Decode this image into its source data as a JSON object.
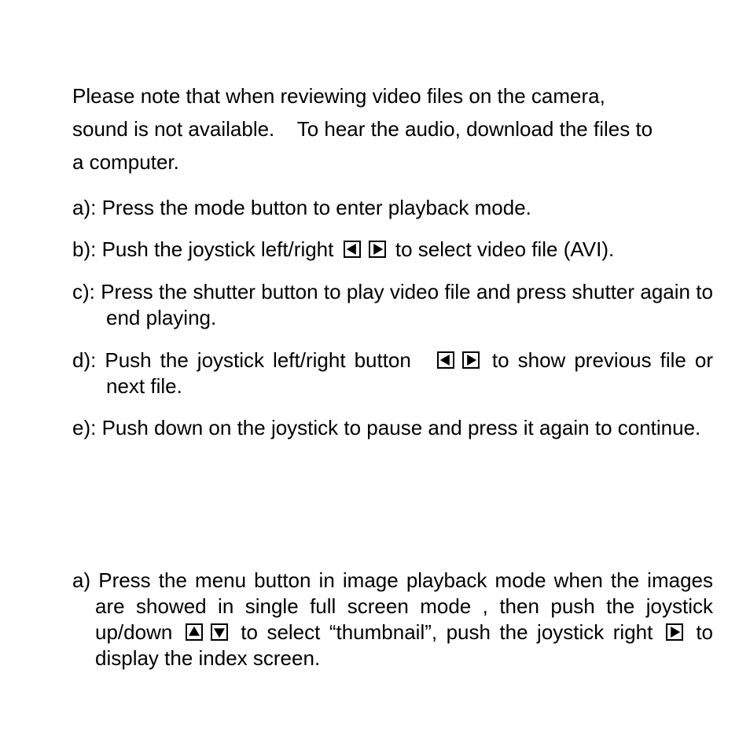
{
  "intro": {
    "line1": "Please note that when reviewing video files on the camera,",
    "line2": "sound is not available.    To hear the audio, download the files to",
    "line3": "a computer."
  },
  "video_steps": {
    "a": "a): Press the mode button to enter playback mode.",
    "b_pre": "b): Push the joystick left/right",
    "b_post": "to select video file (AVI).",
    "c": "c): Press the shutter button to play video file and press shutter again to end playing.",
    "d_pre": "d): Push the joystick left/right button",
    "d_post": "to show previous file or next file.",
    "e": "e): Push down on the joystick to pause and press it again to continue."
  },
  "thumbnail_steps": {
    "a_pre": "a) Press the menu button in image playback mode when the images are showed in single full screen mode , then push the joystick up/down",
    "a_mid": "to select “thumbnail”, push the joystick right",
    "a_post": "to display the index screen."
  },
  "icons": {
    "left": "joystick-left-icon",
    "right": "joystick-right-icon",
    "up": "joystick-up-icon",
    "down": "joystick-down-icon"
  }
}
